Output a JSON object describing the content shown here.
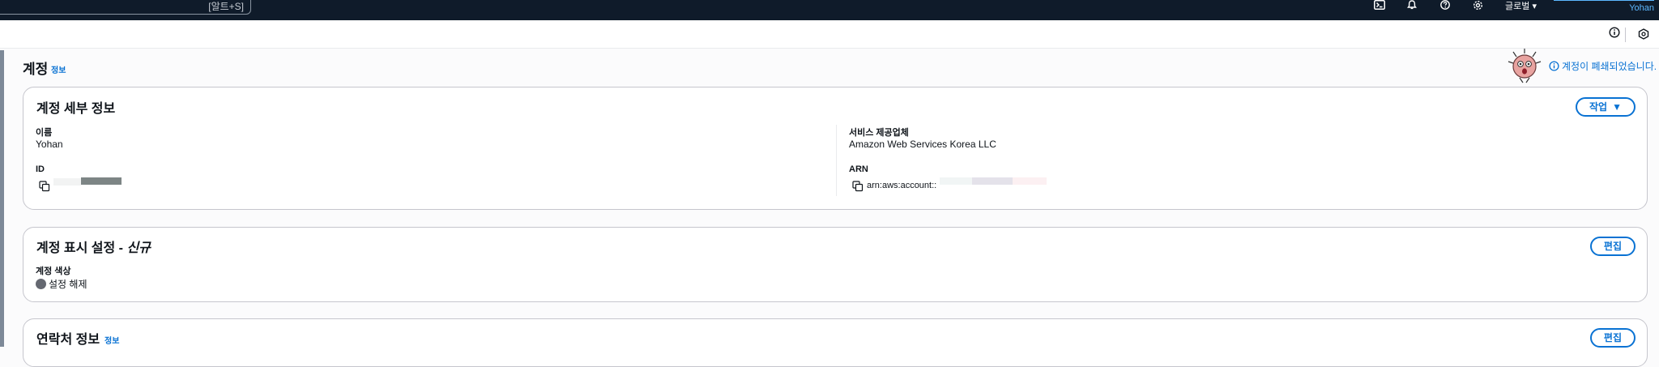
{
  "topbar": {
    "search_shortcut": "[알트+S]",
    "region_label": "글로벌",
    "user_name": "Yohan",
    "icons": [
      "cloudshell-icon",
      "bell-icon",
      "help-icon",
      "gear-icon"
    ]
  },
  "page": {
    "title": "계정",
    "info_label": "정보",
    "closed_notice": "계정이 폐쇄되었습니다."
  },
  "account_details": {
    "title": "계정 세부 정보",
    "action_button": "작업",
    "name_label": "이름",
    "name_value": "Yohan",
    "id_label": "ID",
    "provider_label": "서비스 제공업체",
    "provider_value": "Amazon Web Services Korea LLC",
    "arn_label": "ARN",
    "arn_value": "arn:aws:account::"
  },
  "display_settings": {
    "title_prefix": "계정 표시 설정 - ",
    "title_new": "신규",
    "edit_button": "편집",
    "color_label": "계정 색상",
    "color_value": "설정 해제"
  },
  "contact_info": {
    "title": "연락처 정보",
    "info_label": "정보",
    "edit_button": "편집"
  },
  "colors": {
    "topbar_bg": "#0f1b2a",
    "link_blue": "#0972d3",
    "border": "#c6c6cd"
  }
}
